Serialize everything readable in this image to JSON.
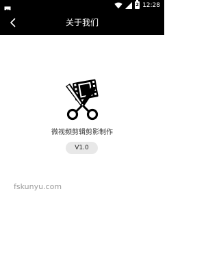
{
  "status_bar": {
    "time": "12:28",
    "battery_level": "2",
    "notification_icon": "image-icon",
    "icons": [
      "wifi-icon",
      "signal-icon",
      "battery-icon"
    ]
  },
  "app_bar": {
    "title": "关于我们",
    "back_icon": "chevron-left-icon"
  },
  "about": {
    "logo_icon": "scissors-film-icon",
    "app_name": "微视频剪辑剪影制作",
    "version": "V1.0"
  },
  "watermark": "fskunyu.com",
  "colors": {
    "bar_background": "#000000",
    "page_background": "#ffffff",
    "badge_background": "#e8e8e8",
    "watermark": "#9a9a9a"
  }
}
